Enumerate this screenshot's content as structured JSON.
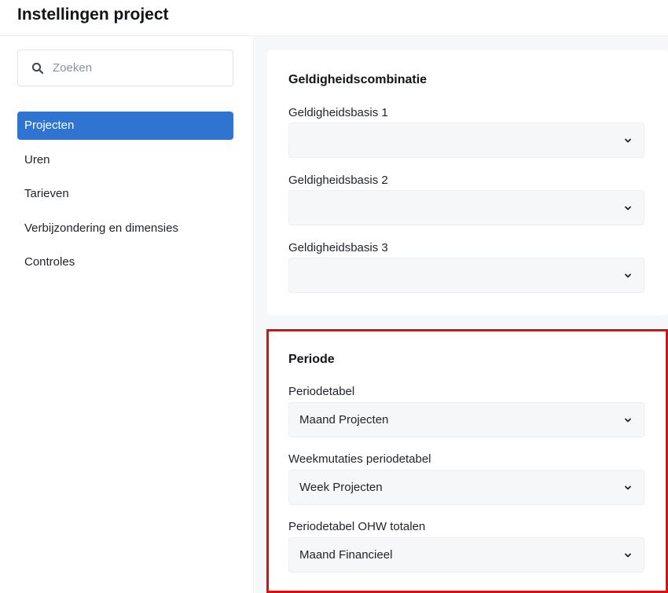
{
  "header": {
    "title": "Instellingen project"
  },
  "search": {
    "placeholder": "Zoeken",
    "value": ""
  },
  "sidebar": {
    "items": [
      {
        "label": "Projecten",
        "active": true
      },
      {
        "label": "Uren",
        "active": false
      },
      {
        "label": "Tarieven",
        "active": false
      },
      {
        "label": "Verbijzondering en dimensies",
        "active": false
      },
      {
        "label": "Controles",
        "active": false
      }
    ]
  },
  "geldigheid": {
    "title": "Geldigheidscombinatie",
    "fields": [
      {
        "label": "Geldigheidsbasis 1",
        "value": ""
      },
      {
        "label": "Geldigheidsbasis 2",
        "value": ""
      },
      {
        "label": "Geldigheidsbasis 3",
        "value": ""
      }
    ]
  },
  "periode": {
    "title": "Periode",
    "fields": [
      {
        "label": "Periodetabel",
        "value": "Maand Projecten"
      },
      {
        "label": "Weekmutaties periodetabel",
        "value": "Week Projecten"
      },
      {
        "label": "Periodetabel OHW totalen",
        "value": "Maand Financieel"
      }
    ]
  },
  "colors": {
    "accent": "#2f74d0",
    "highlight": "#e00d0d",
    "content_bg": "#f6f7f9"
  },
  "icons": {
    "search": "search-icon",
    "dropdown": "chevron-down-icon"
  }
}
